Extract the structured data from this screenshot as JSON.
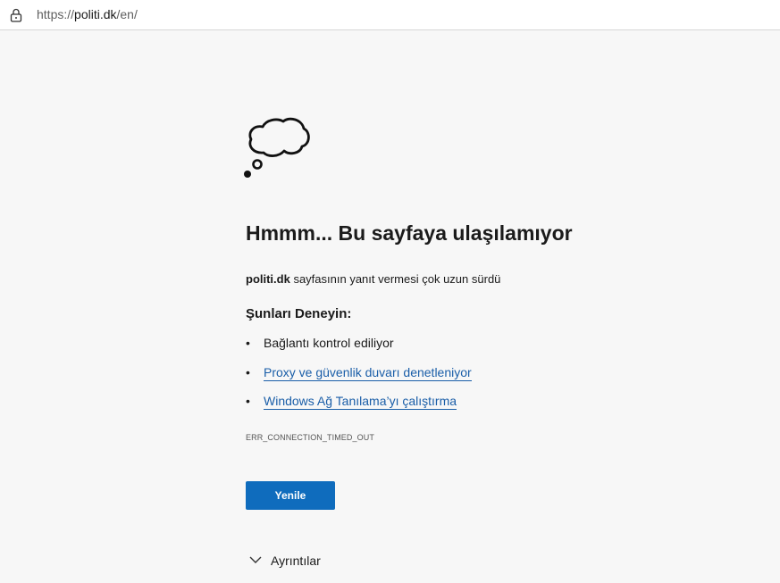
{
  "address_bar": {
    "url_prefix": "https://",
    "url_host": "politi.dk",
    "url_path": "/en/",
    "lock_icon": "lock-icon"
  },
  "error_page": {
    "icon": "thought-cloud-icon",
    "heading": "Hmmm... Bu sayfaya ulaşılamıyor",
    "description_host": "politi.dk",
    "description_text": " sayfasının yanıt vermesi çok uzun sürdü",
    "try_heading": "Şunları Deneyin:",
    "suggestions": [
      {
        "bullet": "•",
        "text": "Bağlantı kontrol ediliyor",
        "is_link": false
      },
      {
        "bullet": "•",
        "text": "Proxy ve güvenlik duvarı denetleniyor",
        "is_link": true
      },
      {
        "bullet": "•",
        "text": "Windows Ağ Tanılama’yı çalıştırma",
        "is_link": true
      }
    ],
    "error_code": "ERR_CONNECTION_TIMED_OUT",
    "reload_label": "Yenile",
    "details_label": "Ayrıntılar",
    "details_icon": "chevron-down-icon"
  },
  "colors": {
    "background": "#f7f7f7",
    "button": "#0f6cbd",
    "link": "#1a5ea8"
  }
}
